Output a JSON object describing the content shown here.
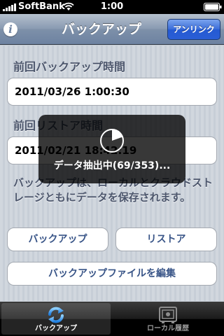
{
  "status_bar": {
    "carrier": "SoftBank",
    "time": "1:00",
    "icons": [
      "signal-bars-icon",
      "wifi-icon",
      "battery-icon"
    ]
  },
  "nav": {
    "title": "バックアップ",
    "info_icon_glyph": "i",
    "right_button": "アンリンク"
  },
  "backup_section": {
    "label": "前回バックアップ時間",
    "value": "2011/03/26  1:00:30"
  },
  "restore_section": {
    "label": "前回リストア時間",
    "value": "2011/02/21  18:42:19"
  },
  "description": "バックアップは、ローカルとクラウドストレージともにデータを保存されます。",
  "buttons": {
    "backup": "バックアップ",
    "restore": "リストア",
    "edit_files": "バックアップファイルを編集"
  },
  "progress_hud": {
    "text": "データ抽出中(69/353)...",
    "progress": 0.195
  },
  "tabs": [
    {
      "label": "バックアップ",
      "icon": "sync-arrows-icon",
      "selected": true
    },
    {
      "label": "ローカル履歴",
      "icon": "safe-icon",
      "selected": false
    }
  ],
  "colors": {
    "nav_bar": "#6d82a1",
    "accent_button": "#2a5ed6",
    "label_text": "#4c566c",
    "button_text": "#385487"
  }
}
